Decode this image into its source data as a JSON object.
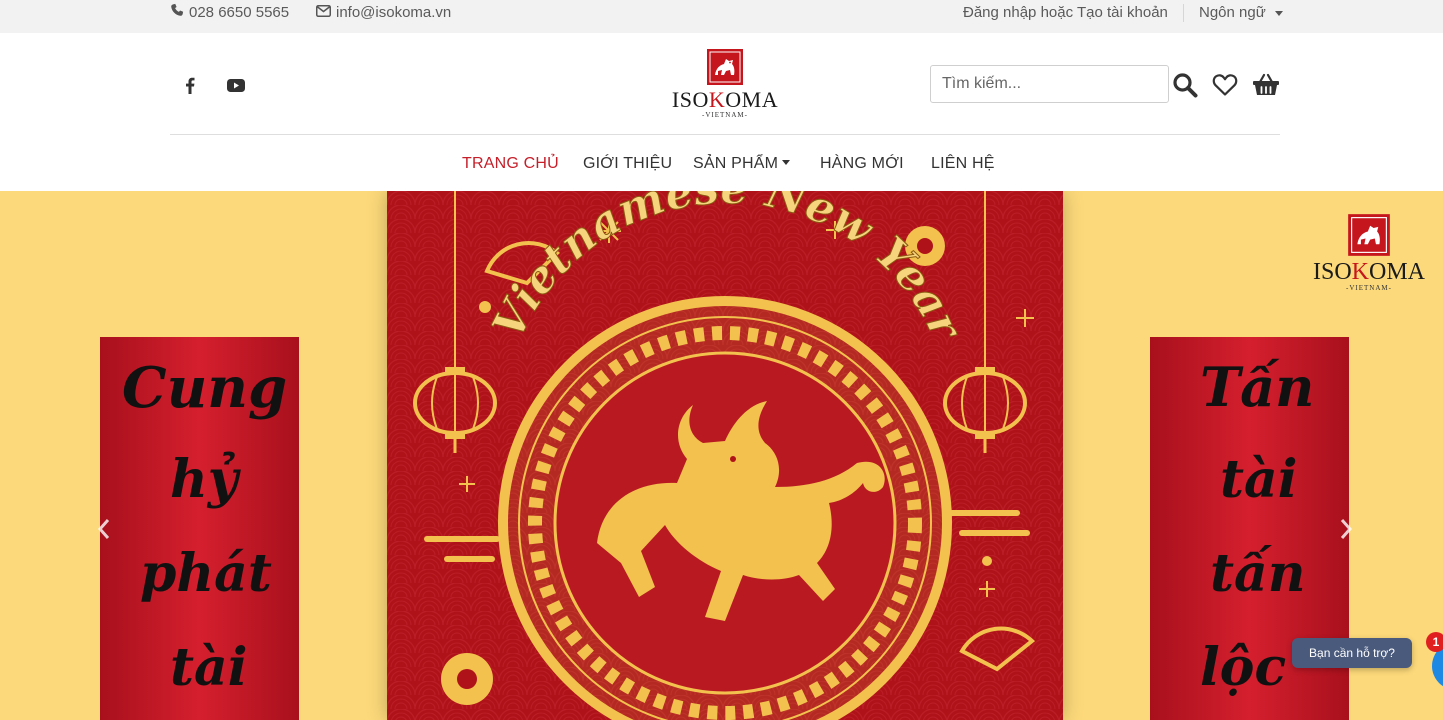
{
  "topbar": {
    "phone": "028 6650 5565",
    "email": "info@isokoma.vn",
    "login": "Đăng nhập hoặc Tạo tài khoản",
    "language": "Ngôn ngữ"
  },
  "header": {
    "social": [
      "facebook-icon",
      "youtube-icon"
    ],
    "logo": {
      "brand_a": "ISO",
      "brand_k": "K",
      "brand_b": "OMA",
      "sub": "-VIETNAM-"
    },
    "search": {
      "placeholder": "Tìm kiếm..."
    },
    "icons": [
      "search-icon",
      "heart-icon",
      "basket-icon"
    ]
  },
  "nav": {
    "items": [
      {
        "label": "TRANG CHỦ",
        "active": true
      },
      {
        "label": "GIỚI THIỆU"
      },
      {
        "label": "SẢN PHẨM",
        "dropdown": true
      },
      {
        "label": "HÀNG MỚI"
      },
      {
        "label": "LIÊN HỆ"
      }
    ]
  },
  "banner": {
    "headline": "Vietnamese New Year",
    "left_scroll": [
      "Cung",
      "hỷ",
      "phát",
      "tài"
    ],
    "right_scroll": [
      "Tấn",
      "tài",
      "tấn",
      "lộc"
    ],
    "logo": {
      "brand_a": "ISO",
      "brand_k": "K",
      "brand_b": "OMA",
      "sub": "-VIETNAM-"
    },
    "colors": {
      "background": "#fcd97a",
      "panel": "#b0121a",
      "gold": "#f2c14e"
    }
  },
  "support": {
    "label": "Bạn cần hỗ trợ?",
    "badge": "1"
  }
}
